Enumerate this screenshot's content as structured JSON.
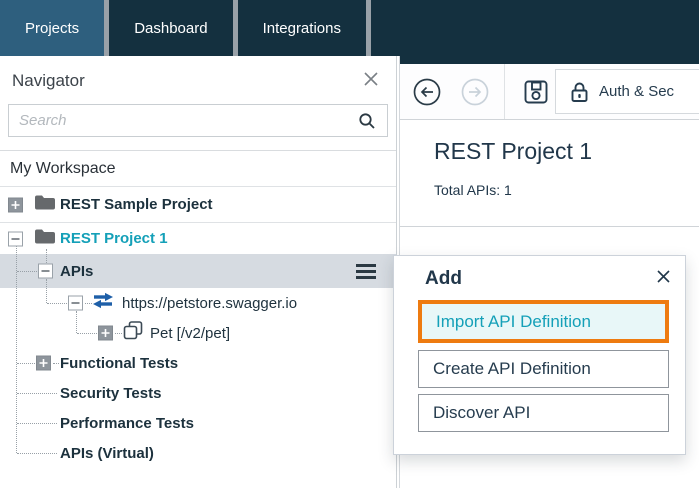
{
  "topnav": {
    "tabs": [
      {
        "label": "Projects",
        "active": true
      },
      {
        "label": "Dashboard",
        "active": false
      },
      {
        "label": "Integrations",
        "active": false
      }
    ]
  },
  "sidebar": {
    "title": "Navigator",
    "search": {
      "placeholder": "Search",
      "value": ""
    },
    "workspace_label": "My Workspace",
    "tree": {
      "rest_sample": "REST Sample Project",
      "rest_project1": "REST Project 1",
      "apis": "APIs",
      "petstore": "https://petstore.swagger.io",
      "pet": "Pet [/v2/pet]",
      "functional": "Functional Tests",
      "security": "Security Tests",
      "performance": "Performance Tests",
      "apis_virtual": "APIs (Virtual)"
    }
  },
  "toolbar": {
    "auth_label": "Auth & Sec"
  },
  "content": {
    "title": "REST Project 1",
    "total_apis": "Total APIs: 1"
  },
  "popup": {
    "title": "Add",
    "buttons": {
      "import": "Import API Definition",
      "create": "Create API Definition",
      "discover": "Discover API"
    }
  },
  "colors": {
    "navbar_bg": "#14303f",
    "active_tab_bg": "#2e5f7e",
    "accent_teal": "#14a0b8",
    "highlight_orange": "#ee7b10",
    "selected_row_bg": "#d6dbe1",
    "link_blue": "#1e5fa8"
  }
}
